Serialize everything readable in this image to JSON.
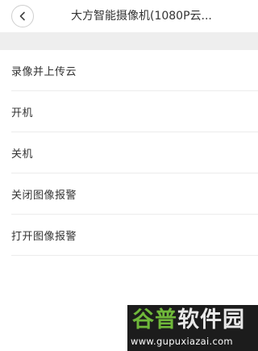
{
  "header": {
    "title": "大方智能摄像机(1080P云..."
  },
  "menu": {
    "items": [
      {
        "label": "录像并上传云"
      },
      {
        "label": "开机"
      },
      {
        "label": "关机"
      },
      {
        "label": "关闭图像报警"
      },
      {
        "label": "打开图像报警"
      }
    ]
  },
  "watermark": {
    "brand_part1": "谷普",
    "brand_part2": "软件园",
    "url": "www.gupuxiazai.com"
  },
  "icons": {
    "back": "chevron-left-icon"
  }
}
